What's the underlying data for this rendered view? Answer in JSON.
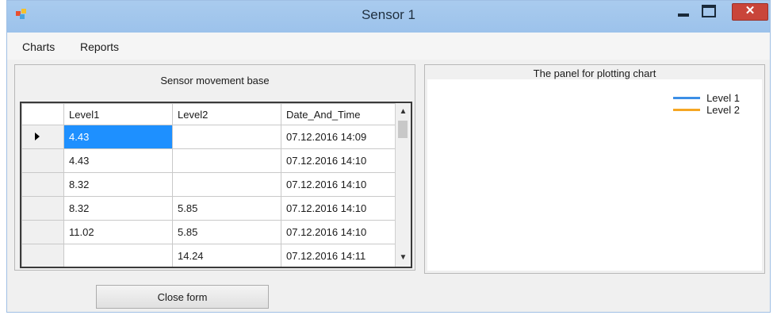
{
  "window": {
    "title": "Sensor 1"
  },
  "controls": {
    "close_glyph": "✕"
  },
  "menu": {
    "items": [
      "Charts",
      "Reports"
    ]
  },
  "grid_panel": {
    "title": "Sensor movement base",
    "columns": [
      "Level1",
      "Level2",
      "Date_And_Time"
    ],
    "rows": [
      {
        "level1": "4.43",
        "level2": "",
        "datetime": "07.12.2016 14:09",
        "selected": true
      },
      {
        "level1": "4.43",
        "level2": "",
        "datetime": "07.12.2016 14:10"
      },
      {
        "level1": "8.32",
        "level2": "",
        "datetime": "07.12.2016 14:10"
      },
      {
        "level1": "8.32",
        "level2": "5.85",
        "datetime": "07.12.2016 14:10"
      },
      {
        "level1": "11.02",
        "level2": "5.85",
        "datetime": "07.12.2016 14:10"
      },
      {
        "level1": "",
        "level2": "14.24",
        "datetime": "07.12.2016 14:11"
      }
    ],
    "scroll_up_glyph": "▲",
    "scroll_down_glyph": "▼"
  },
  "chart_panel": {
    "title": "The panel for plotting chart",
    "legend": [
      {
        "label": "Level 1",
        "color": "#3c8fe6"
      },
      {
        "label": "Level 2",
        "color": "#f5a623"
      }
    ]
  },
  "buttons": {
    "close_form": "Close form"
  },
  "colors": {
    "selection": "#1e90ff",
    "title_bar": "#a9cbee",
    "close_button": "#c9453a"
  }
}
